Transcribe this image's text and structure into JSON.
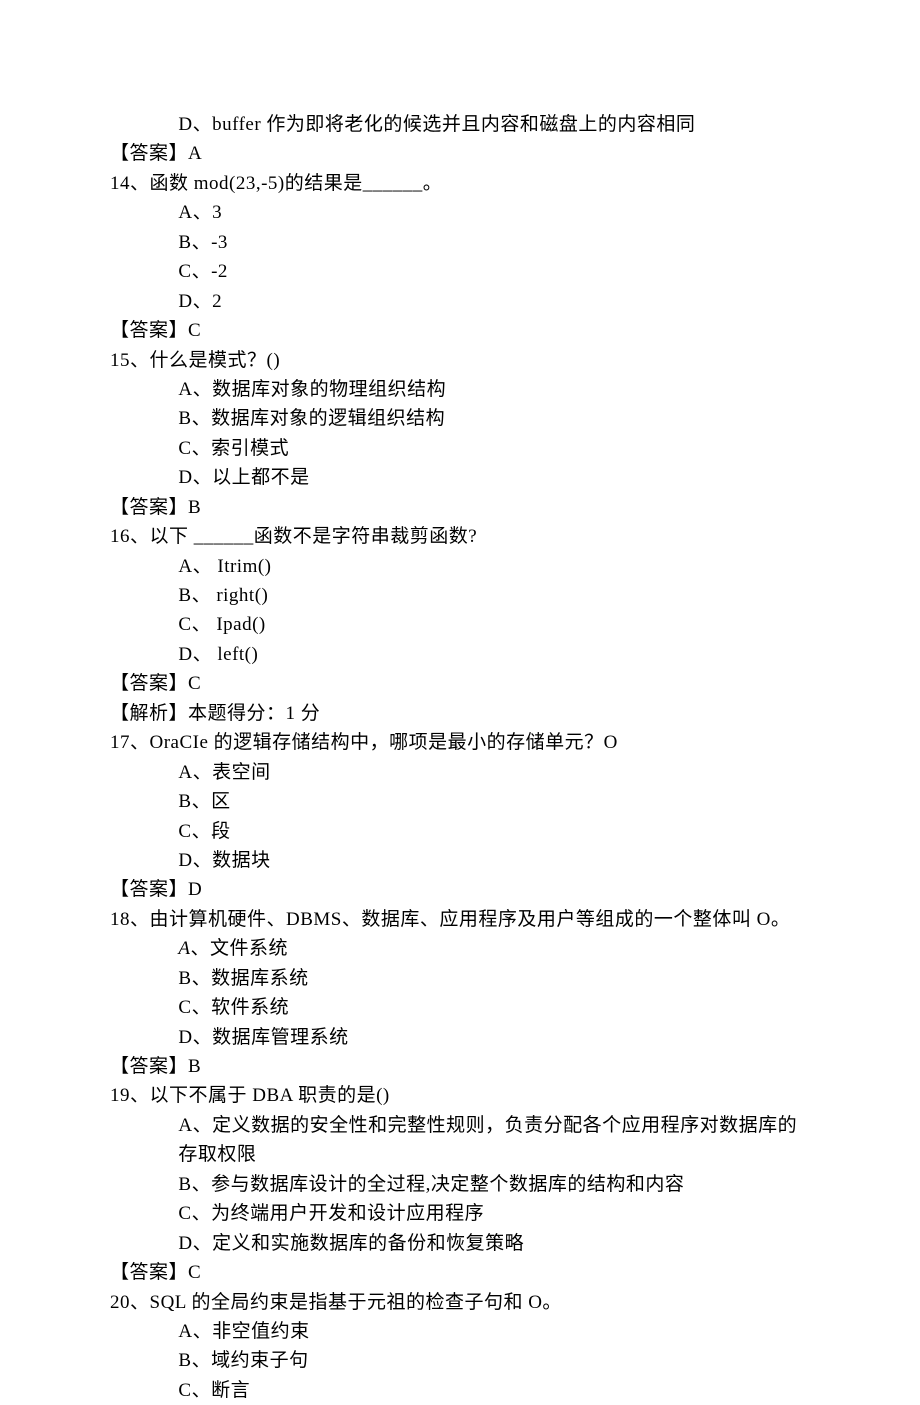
{
  "q13": {
    "option_d": "D、buffer 作为即将老化的候选并且内容和磁盘上的内容相同",
    "answer": "【答案】A"
  },
  "q14": {
    "stem": "14、函数 mod(23,-5)的结果是______。",
    "option_a": "A、3",
    "option_b": "B、-3",
    "option_c": "C、-2",
    "option_d": "D、2",
    "answer": "【答案】C"
  },
  "q15": {
    "stem": "15、什么是模式？()",
    "option_a": "A、数据库对象的物理组织结构",
    "option_b": "B、数据库对象的逻辑组织结构",
    "option_c": "C、索引模式",
    "option_d": "D、以上都不是",
    "answer": "【答案】B"
  },
  "q16": {
    "stem": "16、以下 ______函数不是字符串裁剪函数?",
    "option_a": "A、 Itrim()",
    "option_b": "B、 right()",
    "option_c": "C、 Ipad()",
    "option_d": "D、 left()",
    "answer": "【答案】C",
    "analysis": "【解析】本题得分：1 分"
  },
  "q17": {
    "stem": "17、OraCIe 的逻辑存储结构中，哪项是最小的存储单元？O",
    "option_a": "A、表空间",
    "option_b": "B、区",
    "option_c": "C、段",
    "option_d": "D、数据块",
    "answer": "【答案】D"
  },
  "q18": {
    "stem": "18、由计算机硬件、DBMS、数据库、应用程序及用户等组成的一个整体叫 O。",
    "option_a_prefix": "A",
    "option_a_rest": "、文件系统",
    "option_b": "B、数据库系统",
    "option_c": "C、软件系统",
    "option_d": "D、数据库管理系统",
    "answer": "【答案】B"
  },
  "q19": {
    "stem": "19、以下不属于 DBA 职责的是()",
    "option_a": "A、定义数据的安全性和完整性规则，负责分配各个应用程序对数据库的存取权限",
    "option_b": "B、参与数据库设计的全过程,决定整个数据库的结构和内容",
    "option_c": "C、为终端用户开发和设计应用程序",
    "option_d": "D、定义和实施数据库的备份和恢复策略",
    "answer": "【答案】C"
  },
  "q20": {
    "stem": "20、SQL 的全局约束是指基于元祖的检查子句和 O。",
    "option_a": "A、非空值约束",
    "option_b": "B、域约束子句",
    "option_c": "C、断言"
  }
}
